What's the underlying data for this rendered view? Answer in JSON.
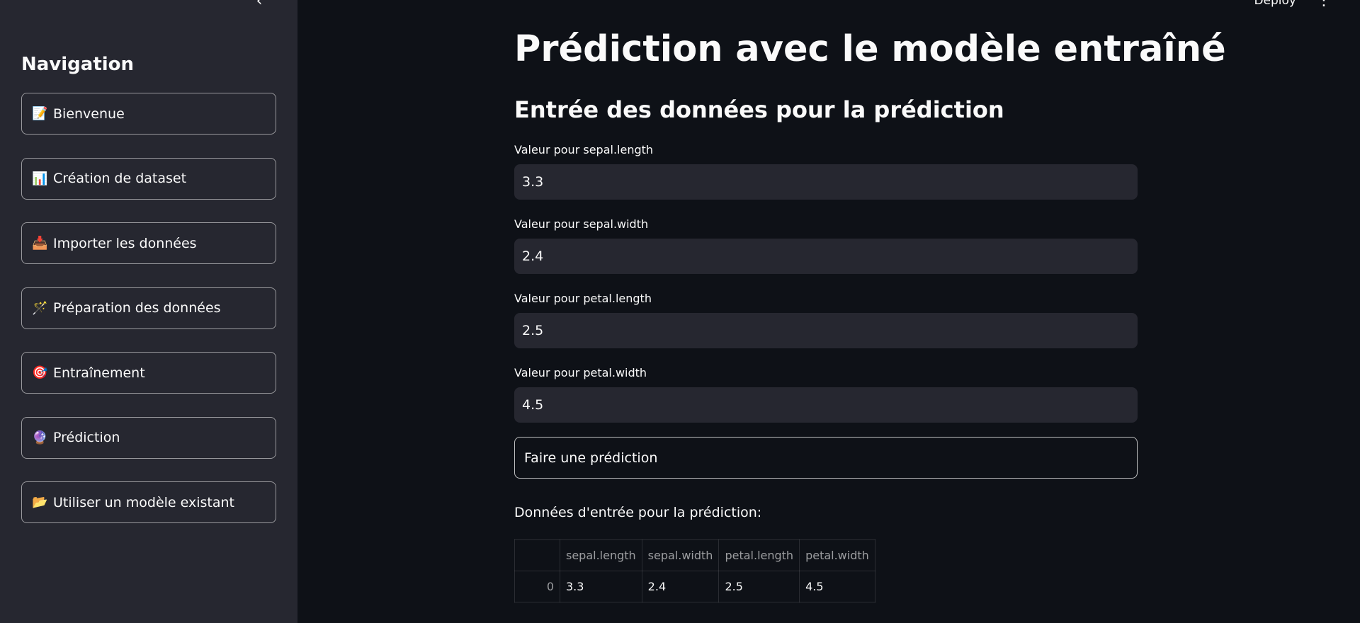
{
  "sidebar": {
    "title": "Navigation",
    "collapse_icon": "‹",
    "items": [
      {
        "icon": "📝",
        "label": "Bienvenue"
      },
      {
        "icon": "📊",
        "label": "Création de dataset"
      },
      {
        "icon": "📥",
        "label": "Importer les données"
      },
      {
        "icon": "🪄",
        "label": "Préparation des données"
      },
      {
        "icon": "🎯",
        "label": "Entraînement"
      },
      {
        "icon": "🔮",
        "label": "Prédiction"
      },
      {
        "icon": "📂",
        "label": "Utiliser un modèle existant"
      }
    ]
  },
  "header": {
    "deploy_label": "Deploy",
    "menu_icon": "⋮"
  },
  "main": {
    "title": "Prédiction avec le modèle entraîné",
    "section_title": "Entrée des données pour la prédiction",
    "fields": [
      {
        "label": "Valeur pour sepal.length",
        "value": "3.3"
      },
      {
        "label": "Valeur pour sepal.width",
        "value": "2.4"
      },
      {
        "label": "Valeur pour petal.length",
        "value": "2.5"
      },
      {
        "label": "Valeur pour petal.width",
        "value": "4.5"
      }
    ],
    "predict_button": "Faire une prédiction",
    "result_label": "Données d'entrée pour la prédiction:",
    "table": {
      "columns": [
        "sepal.length",
        "sepal.width",
        "petal.length",
        "petal.width"
      ],
      "rows": [
        {
          "index": "0",
          "values": [
            "3.3",
            "2.4",
            "2.5",
            "4.5"
          ]
        }
      ]
    }
  }
}
